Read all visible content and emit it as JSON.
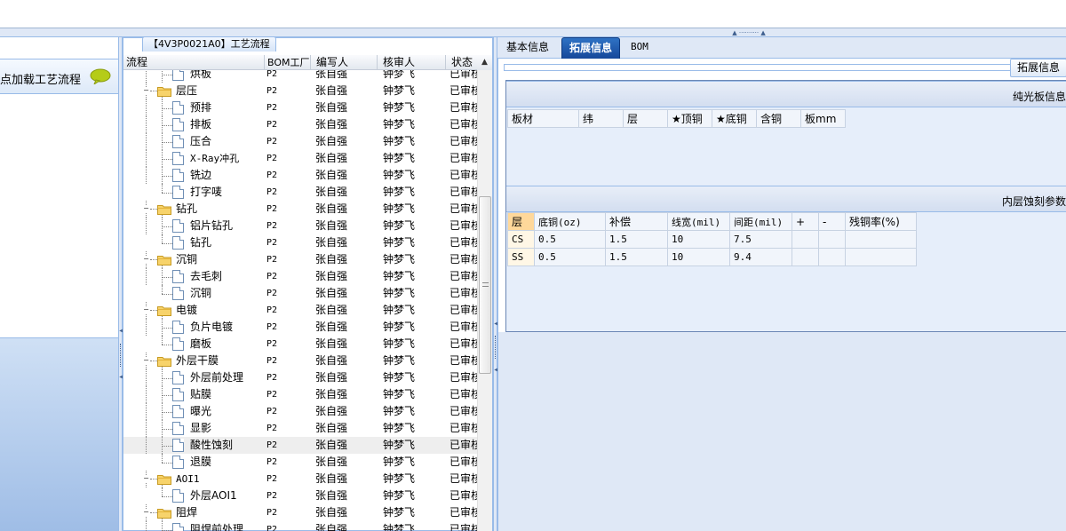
{
  "left_panel": {
    "header_text": "点加载工艺流程"
  },
  "center_panel": {
    "title": "【4V3P0021A0】工艺流程",
    "columns": [
      "流程",
      "BOM工厂",
      "编写人",
      "核审人",
      "状态"
    ],
    "rows": [
      {
        "name": "烘板",
        "level": 2,
        "type": "file",
        "bom": "P2",
        "writer": "张自强",
        "checker": "钟梦飞",
        "status": "已审核",
        "partial": true
      },
      {
        "name": "层压",
        "level": 1,
        "type": "folder",
        "bom": "P2",
        "writer": "张自强",
        "checker": "钟梦飞",
        "status": "已审核"
      },
      {
        "name": "预排",
        "level": 2,
        "type": "file",
        "bom": "P2",
        "writer": "张自强",
        "checker": "钟梦飞",
        "status": "已审核"
      },
      {
        "name": "排板",
        "level": 2,
        "type": "file",
        "bom": "P2",
        "writer": "张自强",
        "checker": "钟梦飞",
        "status": "已审核"
      },
      {
        "name": "压合",
        "level": 2,
        "type": "file",
        "bom": "P2",
        "writer": "张自强",
        "checker": "钟梦飞",
        "status": "已审核"
      },
      {
        "name": "X-Ray冲孔",
        "level": 2,
        "type": "file",
        "bom": "P2",
        "writer": "张自强",
        "checker": "钟梦飞",
        "status": "已审核"
      },
      {
        "name": "铣边",
        "level": 2,
        "type": "file",
        "bom": "P2",
        "writer": "张自强",
        "checker": "钟梦飞",
        "status": "已审核"
      },
      {
        "name": "打字唛",
        "level": 2,
        "type": "file",
        "bom": "P2",
        "writer": "张自强",
        "checker": "钟梦飞",
        "status": "已审核",
        "last": true
      },
      {
        "name": "钻孔",
        "level": 1,
        "type": "folder",
        "bom": "P2",
        "writer": "张自强",
        "checker": "钟梦飞",
        "status": "已审核"
      },
      {
        "name": "铝片钻孔",
        "level": 2,
        "type": "file",
        "bom": "P2",
        "writer": "张自强",
        "checker": "钟梦飞",
        "status": "已审核"
      },
      {
        "name": "钻孔",
        "level": 2,
        "type": "file",
        "bom": "P2",
        "writer": "张自强",
        "checker": "钟梦飞",
        "status": "已审核",
        "last": true
      },
      {
        "name": "沉铜",
        "level": 1,
        "type": "folder",
        "bom": "P2",
        "writer": "张自强",
        "checker": "钟梦飞",
        "status": "已审核"
      },
      {
        "name": "去毛刺",
        "level": 2,
        "type": "file",
        "bom": "P2",
        "writer": "张自强",
        "checker": "钟梦飞",
        "status": "已审核"
      },
      {
        "name": "沉铜",
        "level": 2,
        "type": "file",
        "bom": "P2",
        "writer": "张自强",
        "checker": "钟梦飞",
        "status": "已审核",
        "last": true
      },
      {
        "name": "电镀",
        "level": 1,
        "type": "folder",
        "bom": "P2",
        "writer": "张自强",
        "checker": "钟梦飞",
        "status": "已审核"
      },
      {
        "name": "负片电镀",
        "level": 2,
        "type": "file",
        "bom": "P2",
        "writer": "张自强",
        "checker": "钟梦飞",
        "status": "已审核"
      },
      {
        "name": "磨板",
        "level": 2,
        "type": "file",
        "bom": "P2",
        "writer": "张自强",
        "checker": "钟梦飞",
        "status": "已审核",
        "last": true
      },
      {
        "name": "外层干膜",
        "level": 1,
        "type": "folder",
        "bom": "P2",
        "writer": "张自强",
        "checker": "钟梦飞",
        "status": "已审核"
      },
      {
        "name": "外层前处理",
        "level": 2,
        "type": "file",
        "bom": "P2",
        "writer": "张自强",
        "checker": "钟梦飞",
        "status": "已审核"
      },
      {
        "name": "贴膜",
        "level": 2,
        "type": "file",
        "bom": "P2",
        "writer": "张自强",
        "checker": "钟梦飞",
        "status": "已审核"
      },
      {
        "name": "曝光",
        "level": 2,
        "type": "file",
        "bom": "P2",
        "writer": "张自强",
        "checker": "钟梦飞",
        "status": "已审核"
      },
      {
        "name": "显影",
        "level": 2,
        "type": "file",
        "bom": "P2",
        "writer": "张自强",
        "checker": "钟梦飞",
        "status": "已审核"
      },
      {
        "name": "酸性蚀刻",
        "level": 2,
        "type": "file",
        "bom": "P2",
        "writer": "张自强",
        "checker": "钟梦飞",
        "status": "已审核",
        "selected": true
      },
      {
        "name": "退膜",
        "level": 2,
        "type": "file",
        "bom": "P2",
        "writer": "张自强",
        "checker": "钟梦飞",
        "status": "已审核",
        "last": true
      },
      {
        "name": "AOI1",
        "level": 1,
        "type": "folder",
        "bom": "P2",
        "writer": "张自强",
        "checker": "钟梦飞",
        "status": "已审核"
      },
      {
        "name": "外层AOI1",
        "level": 2,
        "type": "file",
        "bom": "P2",
        "writer": "张自强",
        "checker": "钟梦飞",
        "status": "已审核",
        "last": true
      },
      {
        "name": "阻焊",
        "level": 1,
        "type": "folder",
        "bom": "P2",
        "writer": "张自强",
        "checker": "钟梦飞",
        "status": "已审核"
      },
      {
        "name": "阻焊前处理",
        "level": 2,
        "type": "file",
        "bom": "P2",
        "writer": "张自强",
        "checker": "钟梦飞",
        "status": "已审核"
      }
    ]
  },
  "right_panel": {
    "tabs": [
      "基本信息",
      "拓展信息",
      "BOM"
    ],
    "active_tab": "拓展信息",
    "ext_button": "拓展信息",
    "section1": {
      "title": "纯光板信息",
      "headers": [
        "板材",
        "纬",
        "层",
        "★顶铜",
        "★底铜",
        "含铜",
        "板mm"
      ]
    },
    "section2": {
      "title": "内层蚀刻参数",
      "headers": [
        "层",
        "底铜(oz)",
        "补偿",
        "线宽(mil)",
        "间距(mil)",
        "+",
        "-",
        "残铜率(%)"
      ],
      "rows": [
        [
          "CS",
          "0.5",
          "1.5",
          "10",
          "7.5",
          "",
          "",
          ""
        ],
        [
          "SS",
          "0.5",
          "1.5",
          "10",
          "9.4",
          "",
          "",
          ""
        ]
      ]
    }
  },
  "colors": {
    "panel_border": "#99bbe8",
    "tab_active": "#15479a",
    "panel_bg": "#dfe8f6"
  }
}
